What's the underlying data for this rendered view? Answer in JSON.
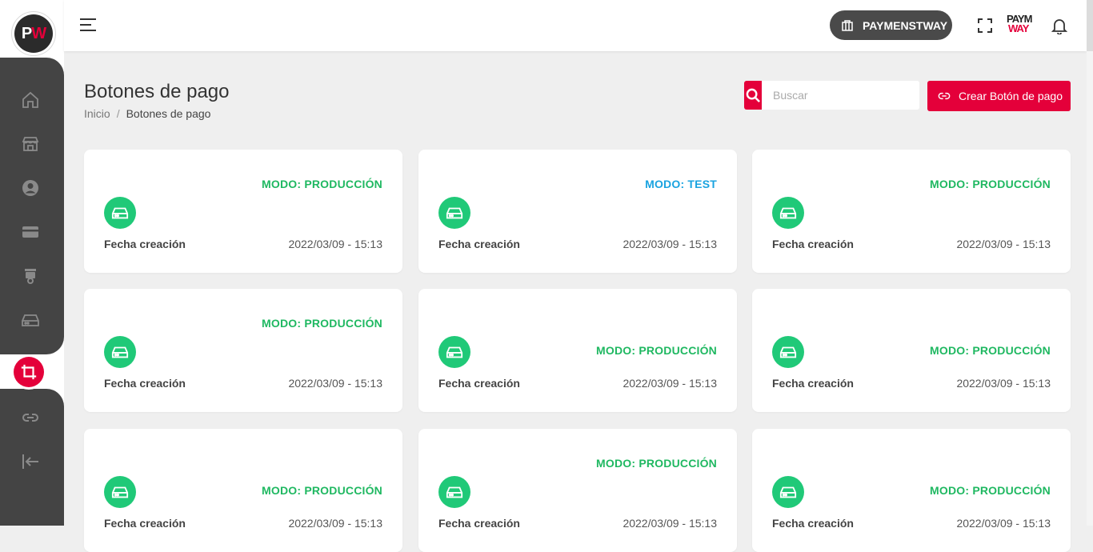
{
  "brand": {
    "logo_p": "P",
    "logo_w": "W",
    "mini_line1": "PAYM",
    "mini_line2": "WAY"
  },
  "topbar": {
    "account_label": "PAYMENSTWAY"
  },
  "page": {
    "title": "Botones de pago",
    "breadcrumb": {
      "home": "Inicio",
      "separator": "/",
      "current": "Botones de pago"
    }
  },
  "search": {
    "placeholder": "Buscar"
  },
  "create_button": {
    "label": "Crear Botón de pago"
  },
  "cards": [
    {
      "mode": "MODO: PRODUCCIÓN",
      "mode_type": "production",
      "date_label": "Fecha creación",
      "date": "2022/03/09 - 15:13"
    },
    {
      "mode": "MODO: TEST",
      "mode_type": "test",
      "date_label": "Fecha creación",
      "date": "2022/03/09 - 15:13"
    },
    {
      "mode": "MODO: PRODUCCIÓN",
      "mode_type": "production",
      "date_label": "Fecha creación",
      "date": "2022/03/09 - 15:13"
    },
    {
      "mode": "MODO: PRODUCCIÓN",
      "mode_type": "production",
      "date_label": "Fecha creación",
      "date": "2022/03/09 - 15:13"
    },
    {
      "mode": "MODO: PRODUCCIÓN",
      "mode_type": "production",
      "date_label": "Fecha creación",
      "date": "2022/03/09 - 15:13"
    },
    {
      "mode": "MODO: PRODUCCIÓN",
      "mode_type": "production",
      "date_label": "Fecha creación",
      "date": "2022/03/09 - 15:13"
    },
    {
      "mode": "MODO: PRODUCCIÓN",
      "mode_type": "production",
      "date_label": "Fecha creación",
      "date": "2022/03/09 - 15:13"
    },
    {
      "mode": "MODO: PRODUCCIÓN",
      "mode_type": "production",
      "date_label": "Fecha creación",
      "date": "2022/03/09 - 15:13"
    },
    {
      "mode": "MODO: PRODUCCIÓN",
      "mode_type": "production",
      "date_label": "Fecha creación",
      "date": "2022/03/09 - 15:13"
    }
  ],
  "sidebar_icons": [
    "home-icon",
    "store-icon",
    "user-icon",
    "card-icon",
    "cctv-icon",
    "drive-icon",
    "crop-icon",
    "link-icon",
    "collapse-icon"
  ],
  "colors": {
    "accent": "#e4003a",
    "production": "#1fb861",
    "test": "#1aa3e0",
    "sidebar": "#444444",
    "card_icon": "#20c978"
  }
}
